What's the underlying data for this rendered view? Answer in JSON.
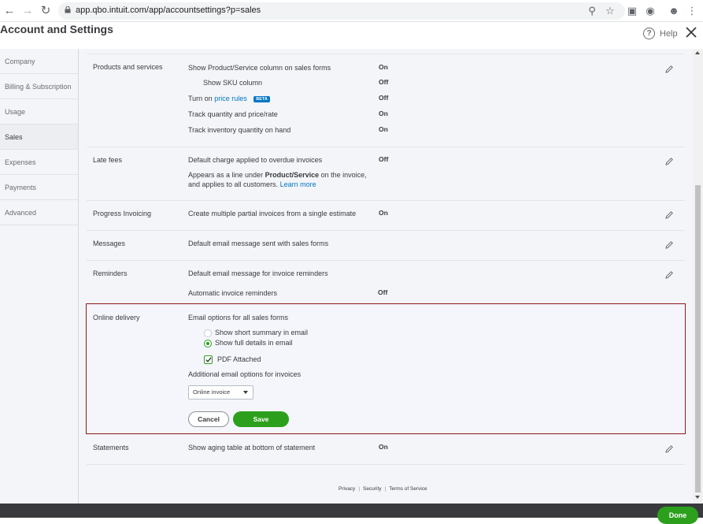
{
  "browser": {
    "back_icon": "arrow-left-icon",
    "forward_icon": "arrow-right-icon",
    "reload_icon": "reload-icon",
    "url": "app.qbo.intuit.com/app/accountsettings?p=sales"
  },
  "header": {
    "title": "Account and Settings",
    "help_label": "Help",
    "help_glyph": "?"
  },
  "sidebar": {
    "items": [
      {
        "label": "Company"
      },
      {
        "label": "Billing & Subscription"
      },
      {
        "label": "Usage"
      },
      {
        "label": "Sales"
      },
      {
        "label": "Expenses"
      },
      {
        "label": "Payments"
      },
      {
        "label": "Advanced"
      }
    ],
    "active": "Sales"
  },
  "sections": {
    "products": {
      "title": "Products and services",
      "rows": [
        {
          "label": "Show Product/Service column on sales forms",
          "value": "On"
        },
        {
          "label": "Show SKU column",
          "value": "Off"
        },
        {
          "label_prefix": "Turn on",
          "link": "price rules",
          "badge": "BETA",
          "value": "Off"
        },
        {
          "label": "Track quantity and price/rate",
          "value": "On"
        },
        {
          "label": "Track inventory quantity on hand",
          "value": "On"
        }
      ]
    },
    "late_fees": {
      "title": "Late fees",
      "label": "Default charge applied to overdue invoices",
      "value": "Off",
      "note_prefix": "Appears as a line under",
      "note_bold": "Product/Service",
      "note_suffix": "on the invoice,",
      "note_line2": "and applies to all customers.",
      "note_link": "Learn more"
    },
    "progress": {
      "title": "Progress Invoicing",
      "label": "Create multiple partial invoices from a single estimate",
      "value": "On"
    },
    "messages": {
      "title": "Messages",
      "label": "Default email message sent with sales forms"
    },
    "reminders": {
      "title": "Reminders",
      "label": "Default email message for invoice reminders",
      "auto_label": "Automatic invoice reminders",
      "auto_value": "Off"
    },
    "online_delivery": {
      "title": "Online delivery",
      "email_options_label": "Email options for all sales forms",
      "radio_short": "Show short summary in email",
      "radio_full": "Show full details in email",
      "selected_radio": "full",
      "pdf_label": "PDF Attached",
      "pdf_checked": true,
      "additional_label": "Additional email options for invoices",
      "invoice_select_value": "Online invoice",
      "cancel_label": "Cancel",
      "save_label": "Save"
    },
    "statements": {
      "title": "Statements",
      "label": "Show aging table at bottom of statement",
      "value": "On"
    }
  },
  "footer": {
    "privacy": "Privacy",
    "security": "Security",
    "terms": "Terms of Service",
    "separator": "|"
  },
  "bottom_bar": {
    "done_label": "Done"
  },
  "colors": {
    "accent_green": "#2ca01c",
    "link_blue": "#0077c5",
    "panel_border": "#8b1a1a",
    "bottom_bar": "#393a3d"
  }
}
